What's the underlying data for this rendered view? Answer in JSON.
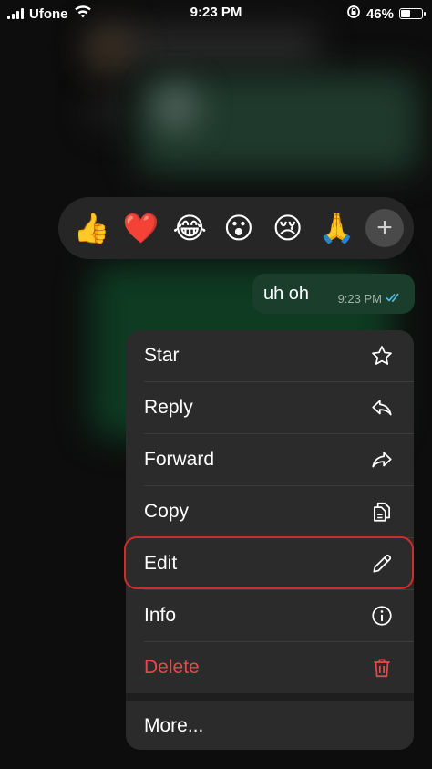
{
  "status_bar": {
    "carrier": "Ufone",
    "time": "9:23 PM",
    "battery": "46%",
    "battery_level": 0.46
  },
  "reactions": [
    {
      "name": "thumbs-up-emoji",
      "glyph": "👍"
    },
    {
      "name": "red-heart-emoji",
      "glyph": "❤️"
    },
    {
      "name": "tears-of-joy-emoji",
      "glyph": "😂"
    },
    {
      "name": "surprised-emoji",
      "glyph": "😮"
    },
    {
      "name": "crying-emoji",
      "glyph": "😢"
    },
    {
      "name": "praying-hands-emoji",
      "glyph": "🙏"
    }
  ],
  "reaction_more": "+",
  "message": {
    "text": "uh oh",
    "time": "9:23 PM",
    "status_icon": "double-check-icon"
  },
  "menu": {
    "items": [
      {
        "label": "Star",
        "icon": "star-icon"
      },
      {
        "label": "Reply",
        "icon": "reply-icon"
      },
      {
        "label": "Forward",
        "icon": "forward-icon"
      },
      {
        "label": "Copy",
        "icon": "copy-icon"
      },
      {
        "label": "Edit",
        "icon": "pencil-icon"
      },
      {
        "label": "Info",
        "icon": "info-icon"
      },
      {
        "label": "Delete",
        "icon": "trash-icon"
      },
      {
        "label": "More..."
      }
    ]
  },
  "colors": {
    "delete": "#e5484d",
    "highlight": "#d22b2b",
    "read_ticks": "#53bdeb"
  }
}
